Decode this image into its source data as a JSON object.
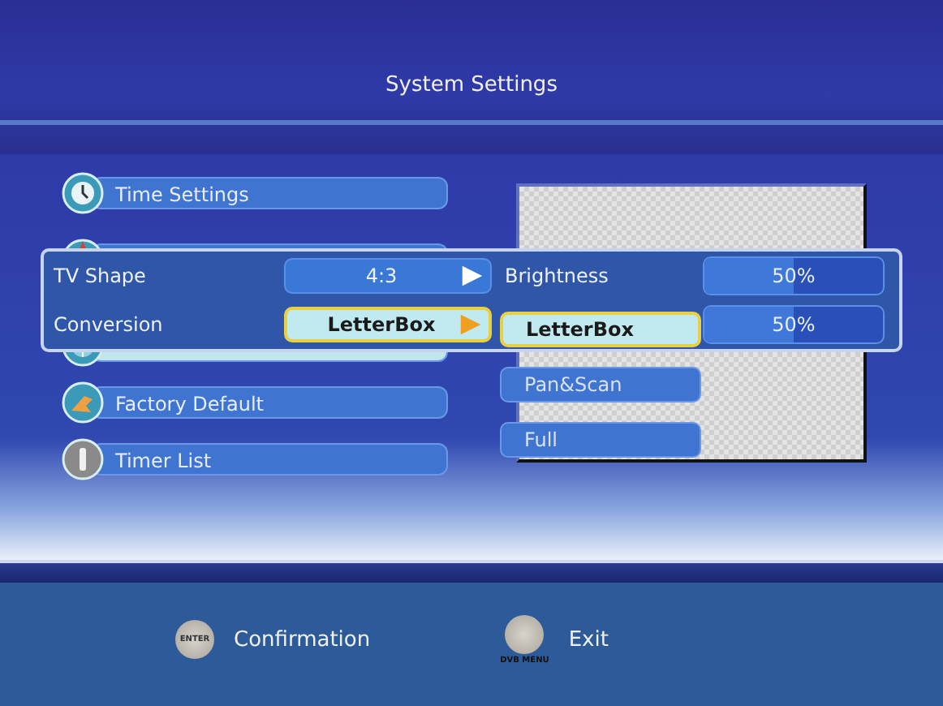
{
  "window": {
    "title": "System Settings"
  },
  "menu": [
    {
      "label": "Time Settings",
      "selected": false
    },
    {
      "selected": false
    },
    {
      "selected": true
    },
    {
      "label": "Factory Default",
      "selected": false
    },
    {
      "label": "Timer List",
      "selected": false
    }
  ],
  "settings": [
    {
      "label": "TV Shape",
      "value": "4:3",
      "focused": false
    },
    {
      "label": "Conversion",
      "value": "LetterBox",
      "focused": true
    }
  ],
  "adjust": [
    {
      "label": "Brightness",
      "reading": "50%",
      "level": 0.5
    },
    {
      "reading": "50%",
      "level": 0.5
    }
  ],
  "options": [
    {
      "label": "LetterBox",
      "selected": true
    },
    {
      "label": "Pan&Scan",
      "selected": false
    },
    {
      "label": "Full",
      "selected": false
    }
  ],
  "hints": [
    {
      "key": "ENTER",
      "text": "Confirmation"
    },
    {
      "key": "DVB MENU",
      "text": "Exit"
    }
  ]
}
